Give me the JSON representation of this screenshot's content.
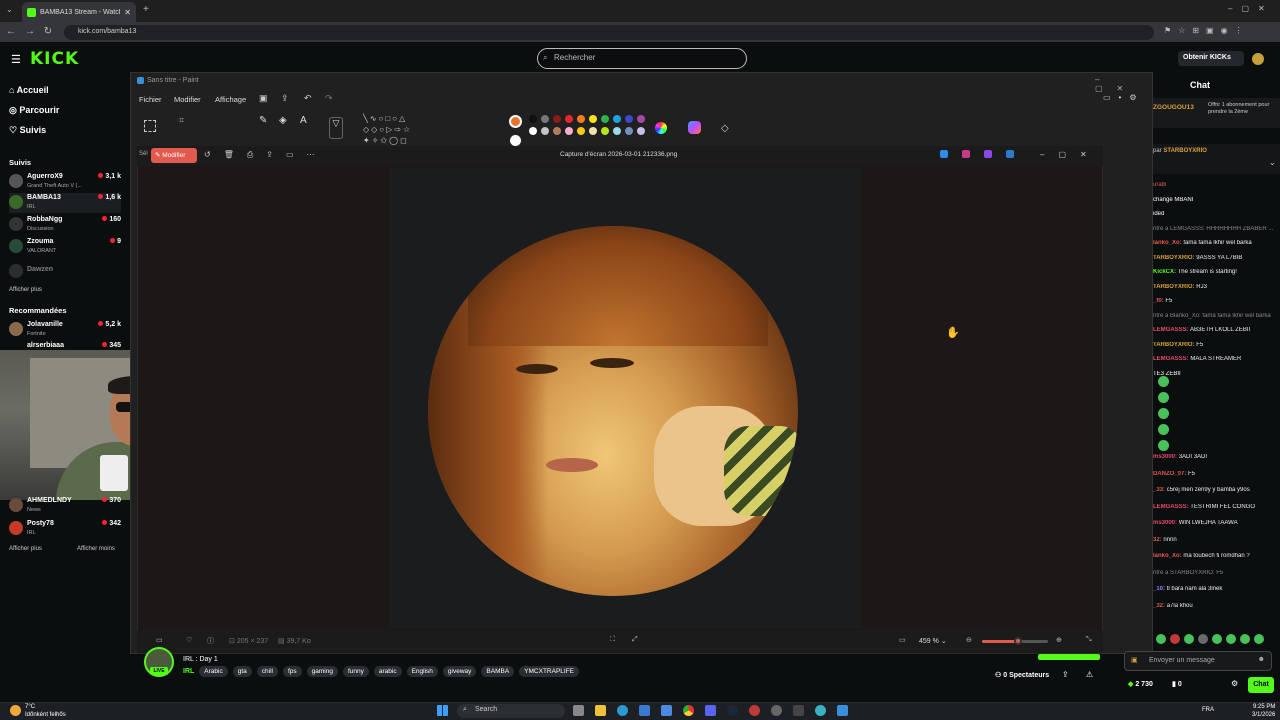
{
  "browser": {
    "tab_title": "BAMBA13 Stream - Watch Live",
    "url": "kick.com/bamba13"
  },
  "kick": {
    "logo": "KICK",
    "search_placeholder": "Rechercher",
    "kicks_button": "Obtenir KICKs"
  },
  "sidebar": {
    "nav": [
      "Accueil",
      "Parcourir",
      "Suivis"
    ],
    "following_header": "Suivis",
    "following": [
      {
        "name": "AguerroX9",
        "category": "Grand Theft Auto V (...",
        "viewers": "3,1 k"
      },
      {
        "name": "BAMBA13",
        "category": "IRL",
        "viewers": "1,6 k"
      },
      {
        "name": "RobbaNgg",
        "category": "Discussion",
        "viewers": "160"
      },
      {
        "name": "Zzouma",
        "category": "VALORANT",
        "viewers": "9"
      },
      {
        "name": "Dawzen",
        "category": "",
        "viewers": ""
      }
    ],
    "show_more": "Afficher plus",
    "recommended_header": "Recommandées",
    "recommended": [
      {
        "name": "Jolavanille",
        "category": "Fortnite",
        "viewers": "5,2 k"
      },
      {
        "name": "alrserbiaaa",
        "category": "",
        "viewers": "345"
      },
      {
        "name": "AHMEDLNDY",
        "category": "News",
        "viewers": "370"
      },
      {
        "name": "Posty78",
        "category": "IRL",
        "viewers": "342"
      }
    ],
    "show_more_2": "Afficher plus",
    "show_less": "Afficher moins"
  },
  "paint": {
    "title": "Sans titre - Paint",
    "menus": [
      "Fichier",
      "Modifier",
      "Affichage"
    ]
  },
  "viewer": {
    "edit_button": "Modifier",
    "file_name": "Capture d'écran 2026-03-01 212336.png",
    "dimensions": "205 × 237",
    "file_size": "39,7 Ko",
    "zoom": "459 %",
    "zoom_level": 0.55
  },
  "chat": {
    "header": "Chat",
    "sub_banner": "ZGOUGOU13",
    "sub_text": "Offrir 1 abonnement pour prendre la 2ème",
    "pinned_user": "STARBOYXRIO",
    "messages": [
      {
        "user": "",
        "text": "urabi",
        "color": "#e05a4e"
      },
      {
        "user": "",
        "text": "changé MBANI",
        "color": "#fff"
      },
      {
        "user": "",
        "text": "ided",
        "color": "#fff"
      },
      {
        "user": "",
        "text": "ntre à LEMGASSS: HHHHHHHH ZBABER ...",
        "color": "#888"
      },
      {
        "user": "lanko_Xo:",
        "text": "fama fama lkhir wel barka",
        "color": "#e05a4e"
      },
      {
        "user": "TARBOYXRIO:",
        "text": "9ASSS YA L7BIB",
        "color": "#d9a23a"
      },
      {
        "user": "KickCX:",
        "text": "The stream is starting!",
        "color": "#53fc18"
      },
      {
        "user": "TARBOYXRIO:",
        "text": "RJ3",
        "color": "#d9a23a"
      },
      {
        "user": "_f0:",
        "text": "F5",
        "color": "#e05a4e"
      },
      {
        "user": "",
        "text": "ntre à Blanko_Xo: fama fama lkhir wel barka",
        "color": "#888"
      },
      {
        "user": "LEMGASSS:",
        "text": "AB3ETH LKOLL ZEBII",
        "color": "#e84a6b"
      },
      {
        "user": "TARBOYXRIO:",
        "text": "F5",
        "color": "#d9a23a"
      },
      {
        "user": "LEMGASSS:",
        "text": "MALA STREAMER",
        "color": "#e84a6b"
      },
      {
        "user": "",
        "text": "TE3 ZEBII",
        "color": "#fff"
      }
    ],
    "messages2": [
      {
        "user": "ms3000:",
        "text": "3ADI 3ADI",
        "color": "#e84a6b"
      },
      {
        "user": "DANZO_07:",
        "text": "F5",
        "color": "#e05a4e"
      },
      {
        "user": "_33:",
        "text": "c5rej men zen9y y bamba y9os",
        "color": "#e05a4e"
      },
      {
        "user": "LEMGASSS:",
        "text": "TESTRIMI FEL CONGO",
        "color": "#e84a6b"
      },
      {
        "user": "ms3000:",
        "text": "WIN LWEJHA TAAWA",
        "color": "#e84a6b"
      },
      {
        "user": "32:",
        "text": "nnnn",
        "color": "#e05a4e"
      },
      {
        "user": "lanko_Xo:",
        "text": "ma toubech fi romdhan ?",
        "color": "#e05a4e"
      },
      {
        "user": "",
        "text": "ntre à STARBOYXRIO: F5",
        "color": "#888"
      },
      {
        "user": "_10:",
        "text": "tl bara nam ala 3lnek",
        "color": "#a07aff"
      },
      {
        "user": "_32:",
        "text": "a7la khou",
        "color": "#e05a4e"
      }
    ],
    "input_placeholder": "Envoyer un message",
    "kicks_count": "2 730",
    "zero_count": "0",
    "send_button": "Chat"
  },
  "stream": {
    "title": "IRL : Day 1",
    "category": "IRL",
    "tags": [
      "Arabic",
      "gta",
      "chill",
      "fps",
      "gaming",
      "funny",
      "arabic",
      "English",
      "giveway",
      "BAMBA",
      "YMCXTRAPLIFE"
    ],
    "viewers": "0 Spectateurs"
  },
  "taskbar": {
    "search": "Search",
    "weather_temp": "7°C",
    "weather_desc": "Időnként felhős",
    "lang": "FRA",
    "time": "9:25 PM",
    "date": "3/1/2026"
  }
}
